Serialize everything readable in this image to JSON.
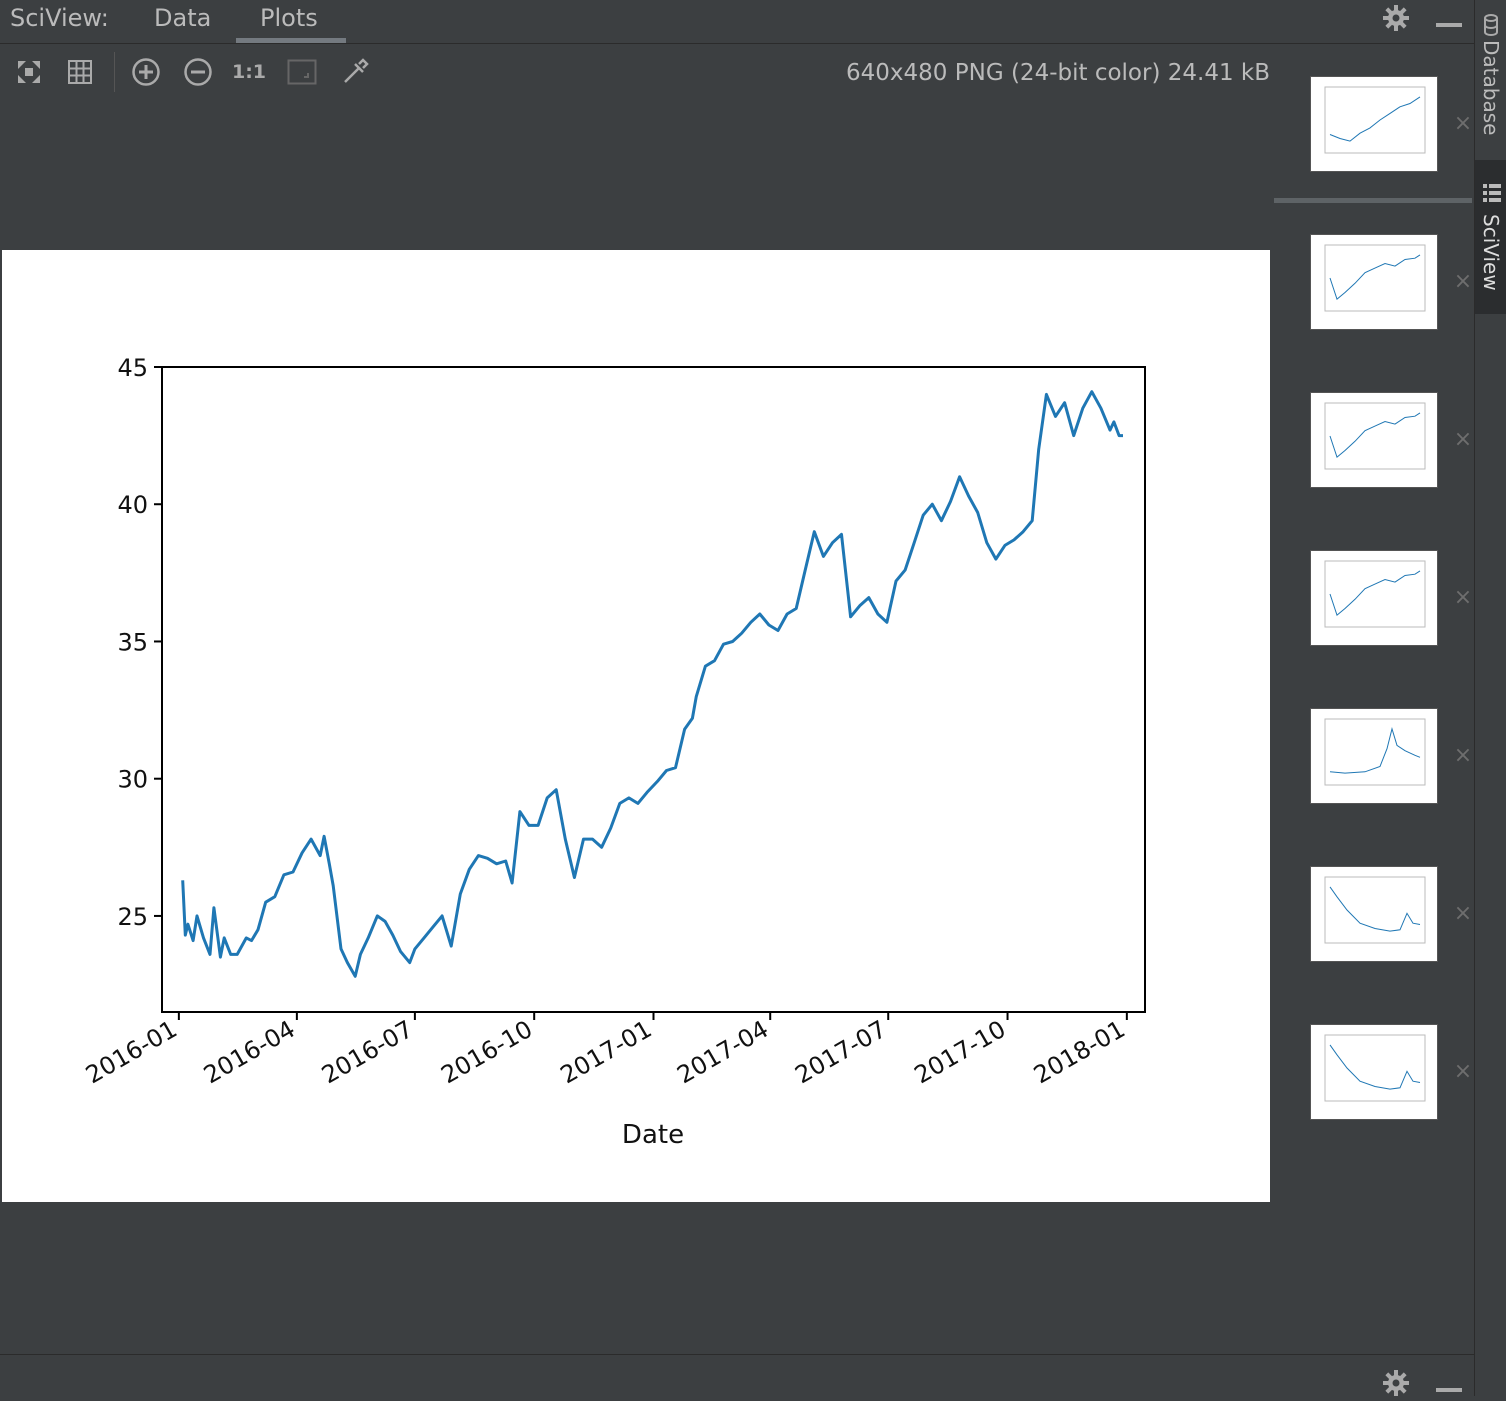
{
  "header": {
    "title": "SciView:",
    "tabs": [
      {
        "label": "Data",
        "active": false
      },
      {
        "label": "Plots",
        "active": true
      }
    ]
  },
  "toolbar": {
    "image_info": "640x480 PNG (24-bit color) 24.41 kB",
    "buttons": [
      "fit-zoom-icon",
      "grid-icon",
      "zoom-in-icon",
      "zoom-out-icon",
      "actual-size-icon",
      "fit-window-icon",
      "color-picker-icon"
    ],
    "actual_size_label": "1:1"
  },
  "side_panel": {
    "tabs": [
      {
        "label": "Database",
        "icon": "database-icon"
      },
      {
        "label": "SciView",
        "icon": "sciview-icon",
        "active": true
      }
    ]
  },
  "thumbnails": [
    {
      "shape": "uptrend-a",
      "selected": true
    },
    {
      "shape": "uptrend-b"
    },
    {
      "shape": "uptrend-b"
    },
    {
      "shape": "uptrend-b"
    },
    {
      "shape": "peak"
    },
    {
      "shape": "decline"
    },
    {
      "shape": "decline"
    }
  ],
  "colors": {
    "line": "#1f77b4",
    "background": "#3c3f41"
  },
  "chart_data": {
    "type": "line",
    "title": "",
    "xlabel": "Date",
    "ylabel": "",
    "x_tick_labels": [
      "2016-01",
      "2016-04",
      "2016-07",
      "2016-10",
      "2017-01",
      "2017-04",
      "2017-07",
      "2017-10",
      "2018-01"
    ],
    "y_ticks": [
      25,
      30,
      35,
      40,
      45
    ],
    "ylim": [
      21.5,
      45
    ],
    "xlim": [
      "2015-12-19",
      "2018-01-15"
    ],
    "series": [
      {
        "x": [
          "2016-01-04",
          "2016-01-06",
          "2016-01-08",
          "2016-01-12",
          "2016-01-15",
          "2016-01-20",
          "2016-01-25",
          "2016-01-28",
          "2016-02-02",
          "2016-02-05",
          "2016-02-10",
          "2016-02-15",
          "2016-02-22",
          "2016-02-26",
          "2016-03-02",
          "2016-03-08",
          "2016-03-15",
          "2016-03-22",
          "2016-03-29",
          "2016-04-05",
          "2016-04-12",
          "2016-04-19",
          "2016-04-22",
          "2016-04-26",
          "2016-04-29",
          "2016-05-05",
          "2016-05-10",
          "2016-05-16",
          "2016-05-20",
          "2016-05-26",
          "2016-06-02",
          "2016-06-08",
          "2016-06-14",
          "2016-06-20",
          "2016-06-27",
          "2016-07-01",
          "2016-07-08",
          "2016-07-15",
          "2016-07-22",
          "2016-07-29",
          "2016-08-05",
          "2016-08-12",
          "2016-08-19",
          "2016-08-26",
          "2016-09-02",
          "2016-09-09",
          "2016-09-14",
          "2016-09-20",
          "2016-09-27",
          "2016-10-04",
          "2016-10-11",
          "2016-10-18",
          "2016-10-25",
          "2016-11-01",
          "2016-11-08",
          "2016-11-15",
          "2016-11-22",
          "2016-11-29",
          "2016-12-06",
          "2016-12-13",
          "2016-12-20",
          "2016-12-27",
          "2017-01-04",
          "2017-01-11",
          "2017-01-18",
          "2017-01-25",
          "2017-01-31",
          "2017-02-03",
          "2017-02-10",
          "2017-02-17",
          "2017-02-24",
          "2017-03-03",
          "2017-03-10",
          "2017-03-17",
          "2017-03-24",
          "2017-03-31",
          "2017-04-07",
          "2017-04-14",
          "2017-04-21",
          "2017-04-28",
          "2017-05-05",
          "2017-05-12",
          "2017-05-19",
          "2017-05-26",
          "2017-06-02",
          "2017-06-09",
          "2017-06-16",
          "2017-06-23",
          "2017-06-30",
          "2017-07-07",
          "2017-07-14",
          "2017-07-21",
          "2017-07-28",
          "2017-08-04",
          "2017-08-11",
          "2017-08-18",
          "2017-08-25",
          "2017-09-01",
          "2017-09-08",
          "2017-09-15",
          "2017-09-22",
          "2017-09-29",
          "2017-10-06",
          "2017-10-13",
          "2017-10-20",
          "2017-10-25",
          "2017-10-31",
          "2017-11-07",
          "2017-11-14",
          "2017-11-21",
          "2017-11-28",
          "2017-12-05",
          "2017-12-12",
          "2017-12-19",
          "2017-12-22",
          "2017-12-26",
          "2017-12-29"
        ],
        "y": [
          26.3,
          24.3,
          24.7,
          24.1,
          25.0,
          24.2,
          23.6,
          25.3,
          23.5,
          24.2,
          23.6,
          23.6,
          24.2,
          24.1,
          24.5,
          25.5,
          25.7,
          26.5,
          26.6,
          27.3,
          27.8,
          27.2,
          27.9,
          26.9,
          26.1,
          23.8,
          23.3,
          22.8,
          23.6,
          24.2,
          25.0,
          24.8,
          24.3,
          23.7,
          23.3,
          23.8,
          24.2,
          24.6,
          25.0,
          23.9,
          25.8,
          26.7,
          27.2,
          27.1,
          26.9,
          27.0,
          26.2,
          28.8,
          28.3,
          28.3,
          29.3,
          29.6,
          27.8,
          26.4,
          27.8,
          27.8,
          27.5,
          28.2,
          29.1,
          29.3,
          29.1,
          29.5,
          29.9,
          30.3,
          30.4,
          31.8,
          32.2,
          33.0,
          34.1,
          34.3,
          34.9,
          35.0,
          35.3,
          35.7,
          36.0,
          35.6,
          35.4,
          36.0,
          36.2,
          37.6,
          39.0,
          38.1,
          38.6,
          38.9,
          35.9,
          36.3,
          36.6,
          36.0,
          35.7,
          37.2,
          37.6,
          38.6,
          39.6,
          40.0,
          39.4,
          40.1,
          41.0,
          40.3,
          39.7,
          38.6,
          38.0,
          38.5,
          38.7,
          39.0,
          39.4,
          42.0,
          44.0,
          43.2,
          43.7,
          42.5,
          43.5,
          44.1,
          43.5,
          42.7,
          43.0,
          42.5,
          42.5
        ]
      }
    ]
  }
}
